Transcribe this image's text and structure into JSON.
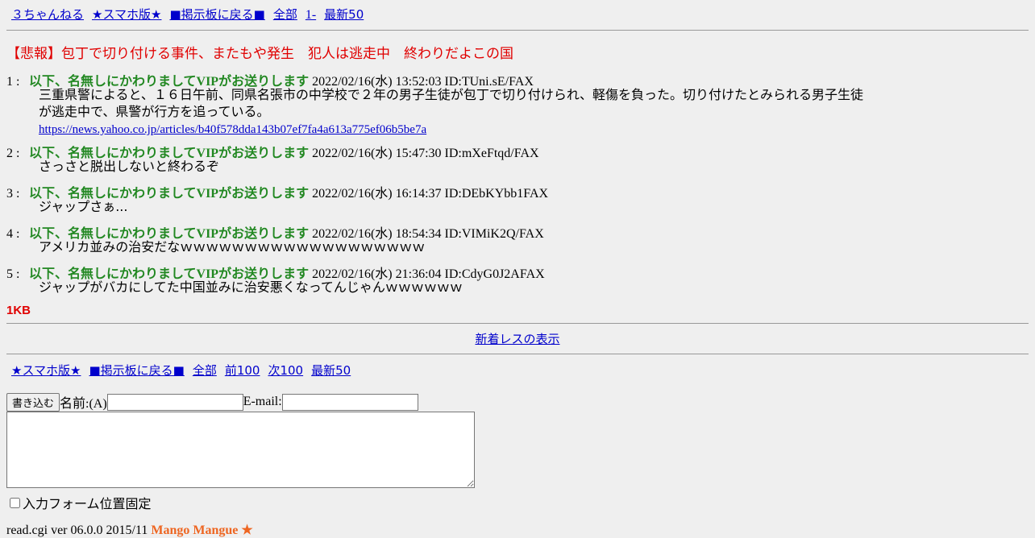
{
  "top_menu": {
    "site": "３ちゃんねる",
    "smartphone": "★スマホ版★",
    "back": "■掲示板に戻る■",
    "all": "全部",
    "range": "1-",
    "latest": "最新50"
  },
  "thread_title": "【悲報】包丁で切り付ける事件、またもや発生　犯人は逃走中　終わりだよこの国",
  "posts": [
    {
      "num": "1 :",
      "name": "以下、名無しにかわりましてVIPがお送りします",
      "meta": "2022/02/16(水) 13:52:03 ID:TUni.sE/FAX",
      "lines": [
        "三重県警によると、１６日午前、同県名張市の中学校で２年の男子生徒が包丁で切り付けられ、軽傷を負った。切り付けたとみられる男子生徒",
        "が逃走中で、県警が行方を追っている。"
      ],
      "link": "https://news.yahoo.co.jp/articles/b40f578dda143b07ef7fa4a613a775ef06b5be7a"
    },
    {
      "num": "2 :",
      "name": "以下、名無しにかわりましてVIPがお送りします",
      "meta": "2022/02/16(水) 15:47:30 ID:mXeFtqd/FAX",
      "lines": [
        "さっさと脱出しないと終わるぞ"
      ]
    },
    {
      "num": "3 :",
      "name": "以下、名無しにかわりましてVIPがお送りします",
      "meta": "2022/02/16(水) 16:14:37 ID:DEbKYbb1FAX",
      "lines": [
        "ジャップさぁ..."
      ]
    },
    {
      "num": "4 :",
      "name": "以下、名無しにかわりましてVIPがお送りします",
      "meta": "2022/02/16(水) 18:54:34 ID:VIMiK2Q/FAX",
      "lines": [
        "アメリカ並みの治安だなｗｗｗｗｗｗｗｗｗｗｗｗｗｗｗｗｗｗｗ"
      ]
    },
    {
      "num": "5 :",
      "name": "以下、名無しにかわりましてVIPがお送りします",
      "meta": "2022/02/16(水) 21:36:04 ID:CdyG0J2AFAX",
      "lines": [
        "ジャップがバカにしてた中国並みに治安悪くなってんじゃんｗｗｗｗｗｗ"
      ]
    }
  ],
  "size": "1KB",
  "new_res": "新着レスの表示",
  "bottom_menu": {
    "smartphone": "★スマホ版★",
    "back": "■掲示板に戻る■",
    "all": "全部",
    "prev": "前100",
    "next": "次100",
    "latest": "最新50"
  },
  "form": {
    "submit": "書き込む",
    "name_label": "名前:(A)",
    "name_value": "",
    "email_label": "E-mail:",
    "email_value": "",
    "message_value": "",
    "fix_label": "入力フォーム位置固定"
  },
  "footer": {
    "version": "read.cgi ver 06.0.0 2015/11",
    "brand": "Mango Mangue ★"
  }
}
